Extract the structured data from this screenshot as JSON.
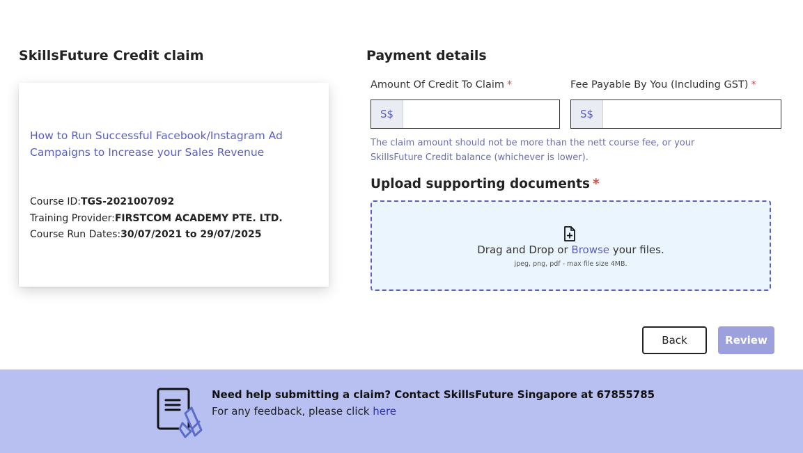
{
  "left": {
    "title": "SkillsFuture Credit claim",
    "course": {
      "name": "How to Run Successful Facebook/Instagram Ad Campaigns to Increase your Sales Revenue",
      "id_label": "Course ID:",
      "id_value": "TGS-2021007092",
      "provider_label": "Training Provider:",
      "provider_value": "FIRSTCOM ACADEMY PTE. LTD.",
      "dates_label": "Course Run Dates:",
      "dates_value": "30/07/2021 to 29/07/2025"
    }
  },
  "payment": {
    "title": "Payment details",
    "amount_label": "Amount Of Credit To Claim",
    "amount_prefix": "S$",
    "amount_value": "",
    "fee_label": "Fee Payable By You (Including GST)",
    "fee_prefix": "S$",
    "fee_value": "",
    "required_marker": "*",
    "hint": "The claim amount should not be more than the nett course fee, or your SkillsFuture Credit balance (whichever is lower)."
  },
  "upload": {
    "title": "Upload supporting documents",
    "drop_text_before": "Drag and Drop or",
    "browse_label": "Browse",
    "drop_text_after": "your files.",
    "sub_text": "jpeg, png, pdf - max file size 4MB.",
    "icon": "file-plus-icon"
  },
  "actions": {
    "back_label": "Back",
    "review_label": "Review"
  },
  "footer": {
    "icon": "document-pen-icon",
    "help_text": "Need help submitting a claim? Contact SkillsFuture Singapore at 67855785",
    "feedback_text": "For any feedback, please click",
    "feedback_link": "here"
  },
  "colors": {
    "accent": "#5a5fc0",
    "required": "#e0453a",
    "footer_bg": "#b7c0f0",
    "review_btn": "#9ca0dd",
    "dropzone_bg": "#ebf5fd"
  }
}
